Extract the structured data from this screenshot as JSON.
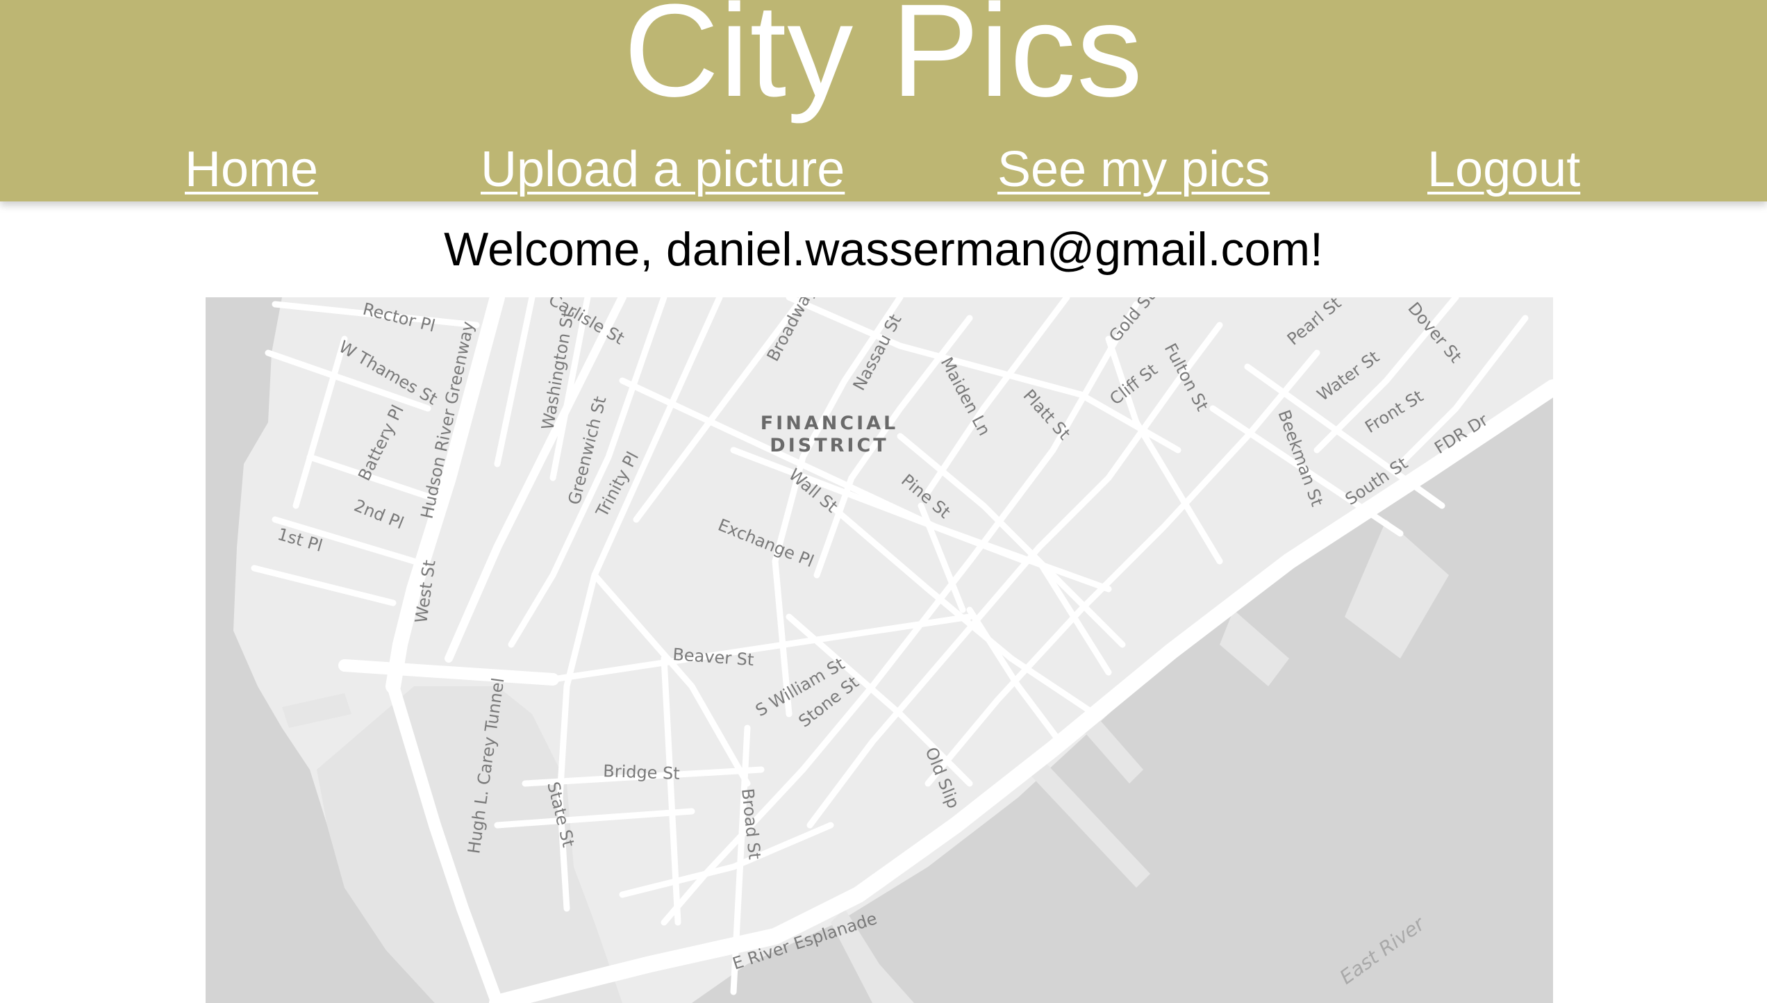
{
  "header": {
    "title": "City Pics",
    "nav": [
      {
        "label": "Home"
      },
      {
        "label": "Upload a picture"
      },
      {
        "label": "See my pics"
      },
      {
        "label": "Logout"
      }
    ]
  },
  "welcome": "Welcome, daniel.wasserman@gmail.com!",
  "map": {
    "district_line1": "FINANCIAL",
    "district_line2": "DISTRICT",
    "water_label": "East River",
    "street_labels": [
      "Rector Pl",
      "Carlisle St",
      "Broadway",
      "Nassau St",
      "Gold St",
      "Fulton St",
      "Pearl St",
      "Dover St",
      "W Thames St",
      "Washington St",
      "Maiden Ln",
      "Cliff St",
      "Water St",
      "Front St",
      "Battery Pl",
      "Hudson River Greenway",
      "Greenwich St",
      "Trinity Pl",
      "Platt St",
      "Beekman St",
      "FDR Dr",
      "South St",
      "2nd Pl",
      "1st Pl",
      "Wall St",
      "Pine St",
      "Exchange Pl",
      "West St",
      "Beaver St",
      "S William St",
      "Stone St",
      "Old Slip",
      "Hugh L. Carey Tunnel",
      "Bridge St",
      "State St",
      "Broad St",
      "E River Esplanade"
    ]
  }
}
